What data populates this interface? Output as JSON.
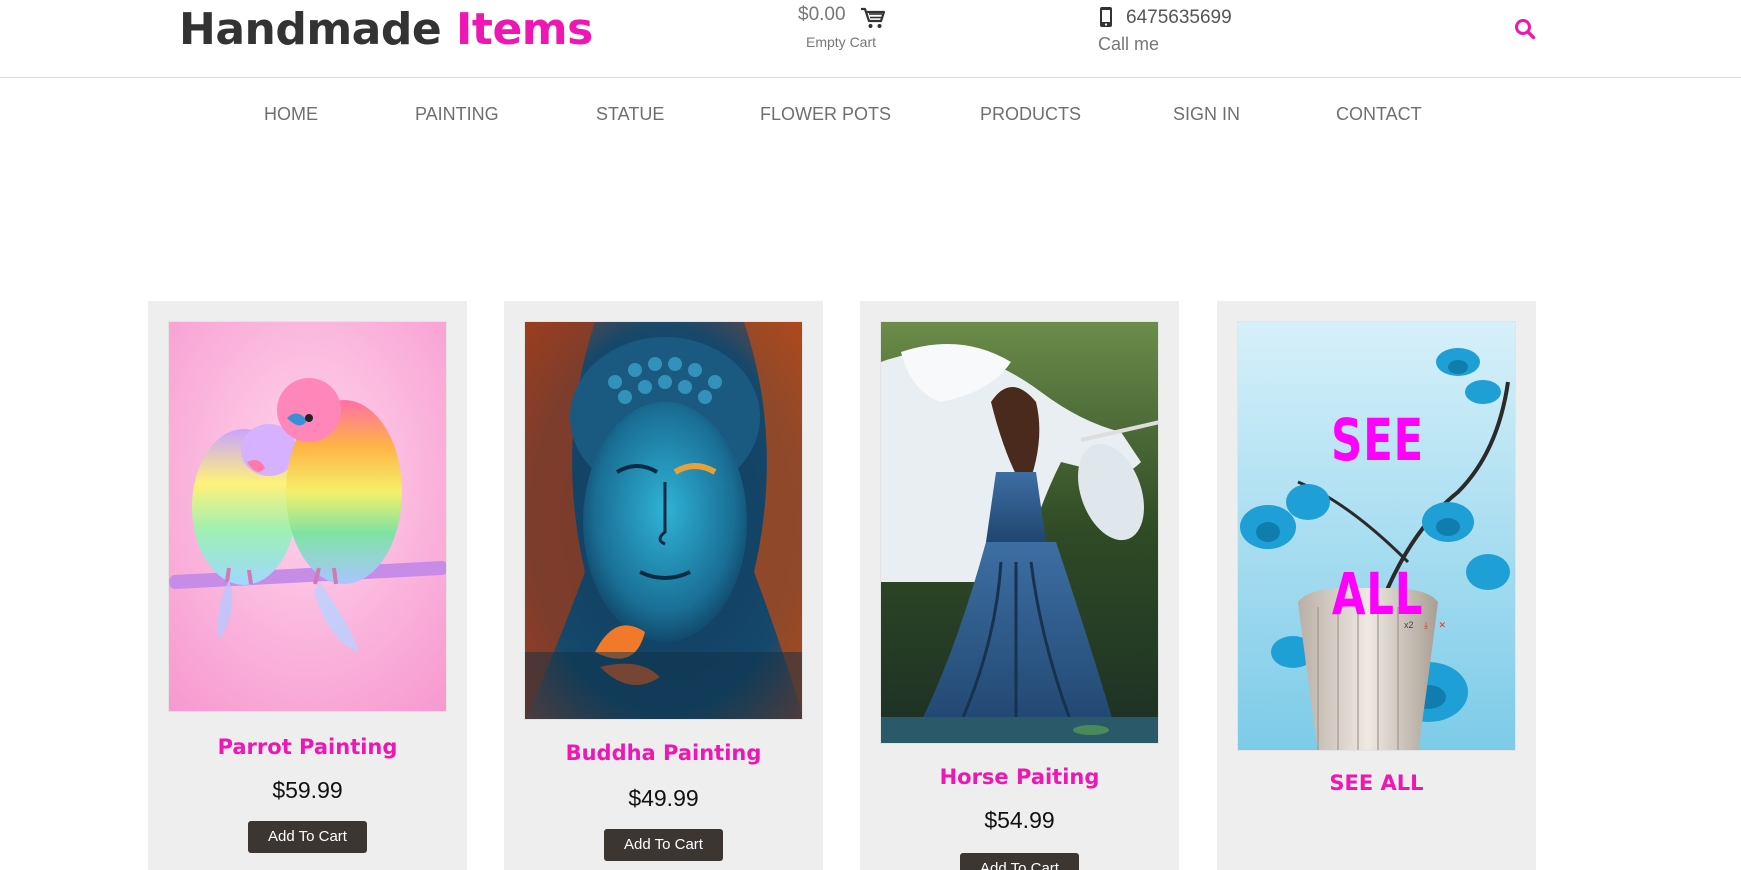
{
  "logo": {
    "part1": "Handmade",
    "part2": "Items"
  },
  "cart": {
    "amount": "$0.00",
    "label": "Empty Cart"
  },
  "phone": {
    "number": "6475635699",
    "label": "Call me"
  },
  "icons": {
    "cart": "cart-icon",
    "phone": "mobile-phone-icon",
    "search": "search-icon"
  },
  "nav": {
    "items": [
      "HOME",
      "PAINTING",
      "STATUE",
      "FLOWER POTS",
      "PRODUCTS",
      "SIGN IN",
      "CONTACT"
    ]
  },
  "products": [
    {
      "title": "Parrot Painting",
      "price": "$59.99",
      "button": "Add To Cart"
    },
    {
      "title": "Buddha Painting",
      "price": "$49.99",
      "button": "Add To Cart"
    },
    {
      "title": "Horse Paiting",
      "price": "$54.99",
      "button": "Add To Cart"
    },
    {
      "title": "SEE ALL",
      "overlay_top": "SEE",
      "overlay_bottom": "ALL",
      "tools": [
        "x2",
        "⤓",
        "✕"
      ]
    }
  ],
  "colors": {
    "accent": "#ee16b4",
    "button": "#3b3632",
    "card_bg": "#eeeeee",
    "nav_text": "#6f6f6f"
  }
}
